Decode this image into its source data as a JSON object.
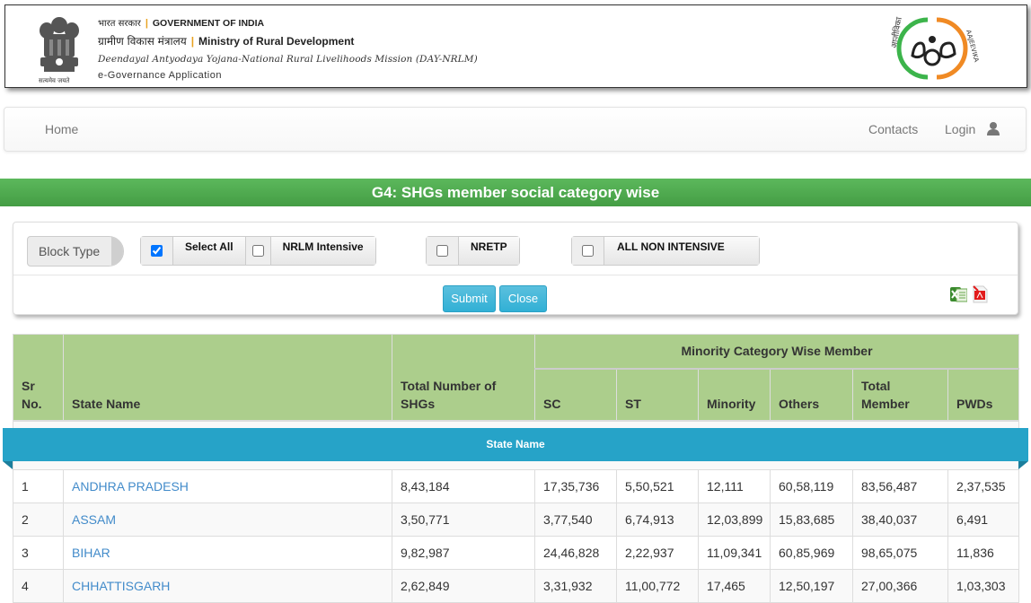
{
  "header": {
    "gov_hindi": "भारत सरकार",
    "gov_english": "GOVERNMENT OF INDIA",
    "ministry_hindi": "ग्रामीण विकास मंत्रालय",
    "ministry_english": "Ministry of Rural Development",
    "mission": "Deendayal Antyodaya Yojana-National Rural Livelihoods Mission (DAY-NRLM)",
    "app_name": "e-Governance Application",
    "emblem_caption": "सत्यमेव जयते",
    "logo_text_left": "आजीविका",
    "logo_text_right": "AAJEEVIKA"
  },
  "navbar": {
    "home": "Home",
    "contacts": "Contacts",
    "login": "Login"
  },
  "page_title": "G4: SHGs member social category wise",
  "filters": {
    "block_type_label": "Block Type",
    "options": [
      {
        "label": "Select All",
        "checked": true
      },
      {
        "label": "NRLM Intensive",
        "checked": false
      },
      {
        "label": "NRETP",
        "checked": false
      },
      {
        "label": "ALL NON INTENSIVE",
        "checked": false
      }
    ],
    "submit_label": "Submit",
    "close_label": "Close"
  },
  "table": {
    "headers": {
      "sr_no": "Sr No.",
      "state_name": "State Name",
      "total_shgs": "Total Number of SHGs",
      "group": "Minority Category Wise Member",
      "sc": "SC",
      "st": "ST",
      "minority": "Minority",
      "others": "Others",
      "total_member": "Total Member",
      "pwds": "PWDs"
    },
    "ribbon_label": "State Name",
    "rows": [
      {
        "sr": "1",
        "state": "ANDHRA PRADESH",
        "shgs": "8,43,184",
        "sc": "17,35,736",
        "st": "5,50,521",
        "minority": "12,111",
        "others": "60,58,119",
        "total": "83,56,487",
        "pwds": "2,37,535"
      },
      {
        "sr": "2",
        "state": "ASSAM",
        "shgs": "3,50,771",
        "sc": "3,77,540",
        "st": "6,74,913",
        "minority": "12,03,899",
        "others": "15,83,685",
        "total": "38,40,037",
        "pwds": "6,491"
      },
      {
        "sr": "3",
        "state": "BIHAR",
        "shgs": "9,82,987",
        "sc": "24,46,828",
        "st": "2,22,937",
        "minority": "11,09,341",
        "others": "60,85,969",
        "total": "98,65,075",
        "pwds": "11,836"
      },
      {
        "sr": "4",
        "state": "CHHATTISGARH",
        "shgs": "2,62,849",
        "sc": "3,31,932",
        "st": "11,00,772",
        "minority": "17,465",
        "others": "12,50,197",
        "total": "27,00,366",
        "pwds": "1,03,303"
      }
    ]
  },
  "colors": {
    "title_green": "#4cae4c",
    "header_green": "#acce8c",
    "ribbon_blue": "#26a3c8",
    "button_blue": "#5bc0de",
    "link_blue": "#428bca"
  }
}
